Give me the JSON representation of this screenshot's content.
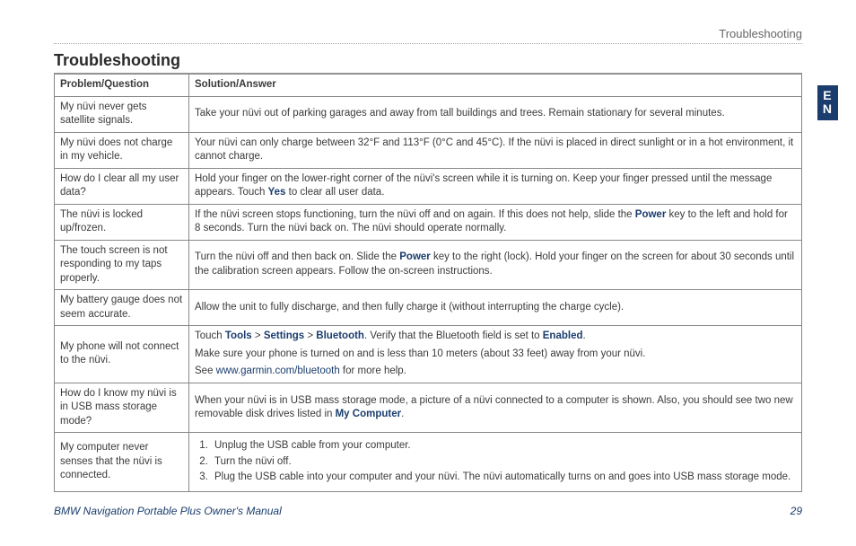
{
  "running_head": "Troubleshooting",
  "section_title": "Troubleshooting",
  "side_tab_line1": "E",
  "side_tab_line2": "N",
  "headers": {
    "problem": "Problem/Question",
    "answer": "Solution/Answer"
  },
  "rows": {
    "r1": {
      "problem": "My nüvi never gets satellite signals.",
      "answer": "Take your nüvi out of parking garages and away from tall buildings and trees. Remain stationary for several minutes."
    },
    "r2": {
      "problem": "My nüvi does not charge in my vehicle.",
      "answer": "Your nüvi can only charge between 32°F and 113°F (0°C and 45°C). If the nüvi is placed in direct sunlight or in a hot environment, it cannot charge."
    },
    "r3": {
      "problem": "How do I clear all my user data?",
      "answer_pre": "Hold your finger on the lower-right corner of the nüvi's screen while it is turning on. Keep your finger pressed until the message appears. Touch ",
      "answer_bold": "Yes",
      "answer_post": " to clear all user data."
    },
    "r4": {
      "problem": "The nüvi is locked up/frozen.",
      "answer_pre": "If the nüvi screen stops functioning, turn the nüvi off and on again. If this does not help, slide the ",
      "answer_bold": "Power",
      "answer_post": " key to the left and hold for 8 seconds. Turn the nüvi back on. The nüvi should operate normally."
    },
    "r5": {
      "problem": "The touch screen is not responding to my taps properly.",
      "answer_pre": "Turn the nüvi off and then back on. Slide the ",
      "answer_bold": "Power",
      "answer_post": " key to the right (lock). Hold your finger on the screen for about 30 seconds until the calibration screen appears. Follow the on-screen instructions."
    },
    "r6": {
      "problem": "My battery gauge does not seem accurate.",
      "answer": "Allow the unit to fully discharge, and then fully charge it (without interrupting the charge cycle)."
    },
    "r7": {
      "problem": "My phone will not connect to the nüvi.",
      "p1_pre": "Touch ",
      "p1_b1": "Tools",
      "p1_sep1": " > ",
      "p1_b2": "Settings",
      "p1_sep2": " > ",
      "p1_b3": "Bluetooth",
      "p1_mid": ". Verify that the Bluetooth field is set to ",
      "p1_b4": "Enabled",
      "p1_end": ".",
      "p2": "Make sure your phone is turned on and is less than 10 meters (about 33 feet) away from your nüvi.",
      "p3_pre": "See ",
      "p3_link": "www.garmin.com/bluetooth",
      "p3_post": " for more help."
    },
    "r8": {
      "problem": "How do I know my nüvi is in USB mass storage mode?",
      "answer_pre": "When your nüvi is in USB mass storage mode, a picture of a nüvi connected to a computer is shown. Also, you should see two new removable disk drives listed in ",
      "answer_bold": "My Computer",
      "answer_post": "."
    },
    "r9": {
      "problem": "My computer never senses that the nüvi is connected.",
      "step1": "Unplug the USB cable from your computer.",
      "step2": "Turn the nüvi off.",
      "step3": "Plug the USB cable into your computer and your nüvi. The nüvi automatically turns on and goes into USB mass storage mode."
    }
  },
  "footer": {
    "left": "BMW Navigation Portable Plus Owner's Manual",
    "right": "29"
  }
}
